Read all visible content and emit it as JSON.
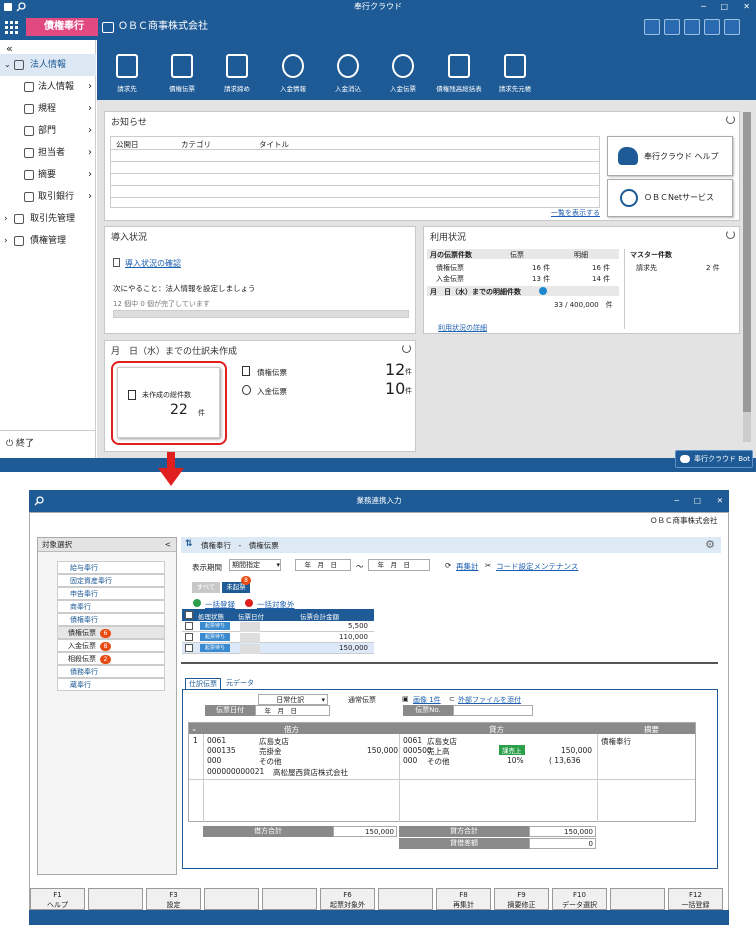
{
  "top_window": {
    "title": "奉行クラウド",
    "app_name": "債権奉行",
    "company": "ＯＢＣ商事株式会社",
    "collapse": "«",
    "nav": [
      {
        "label": "法人情報"
      },
      {
        "label": "法人情報"
      },
      {
        "label": "規程"
      },
      {
        "label": "部門"
      },
      {
        "label": "担当者"
      },
      {
        "label": "摘要"
      },
      {
        "label": "取引銀行"
      },
      {
        "label": "取引先管理"
      },
      {
        "label": "債権管理"
      }
    ],
    "exit_label": "終了",
    "ribbon": [
      "請求先",
      "債権伝票",
      "請求締め",
      "入金情報",
      "入金消込",
      "入金伝票",
      "債権残高総括表",
      "請求先元帳"
    ],
    "notice": {
      "title": "お知らせ",
      "columns": [
        "公開日",
        "カテゴリ",
        "タイトル"
      ],
      "show_all": "一覧を表示する"
    },
    "help_button": "奉行クラウド ヘルプ",
    "obcnet_button": "ＯＢＣNetサービス",
    "intro": {
      "title": "導入状況",
      "confirm_link": "導入状況の確認",
      "next_todo": "次にやること：法人情報を設定しましょう",
      "progress_text": "12 個中 0 個が完了しています",
      "progress_done": 0,
      "progress_total": 12
    },
    "usage": {
      "title": "利用状況",
      "month_header": "月の伝票件数",
      "col_slip": "伝票",
      "col_detail": "明細",
      "rows": [
        {
          "label": "債権伝票",
          "slips": "16 件",
          "details": "16 件"
        },
        {
          "label": "入金伝票",
          "slips": "13 件",
          "details": "14 件"
        }
      ],
      "detail_count_header": "月　日（水）までの明細件数",
      "detail_count": "33 / 400,000　件",
      "detail_link": "利用状況の詳細",
      "master_header": "マスター件数",
      "master_label": "請求先",
      "master_value": "2 件"
    },
    "unjournal": {
      "title": "月　日（水）までの仕訳未作成",
      "card_label": "未作成の総件数",
      "card_value": "22",
      "card_unit": "件",
      "slip1_label": "債権伝票",
      "slip1_count": "12",
      "slip2_label": "入金伝票",
      "slip2_count": "10",
      "unit": "件"
    },
    "bot_button": "奉行クラウド Bot"
  },
  "bottom_window": {
    "title": "業務連携入力",
    "company": "ＯＢＣ商事株式会社",
    "target_label": "対象選択",
    "tree": [
      {
        "label": "給与奉行",
        "badge": ""
      },
      {
        "label": "固定資産奉行",
        "badge": ""
      },
      {
        "label": "申告奉行",
        "badge": ""
      },
      {
        "label": "商奉行",
        "badge": ""
      },
      {
        "label": "債権奉行",
        "badge": ""
      },
      {
        "label": "債権伝票",
        "badge": "6"
      },
      {
        "label": "入金伝票",
        "badge": "8"
      },
      {
        "label": "相殺伝票",
        "badge": "2"
      },
      {
        "label": "債務奉行",
        "badge": ""
      },
      {
        "label": "蔵奉行",
        "badge": ""
      }
    ],
    "breadcrumb": "債権奉行　-　債権伝票",
    "period_label": "表示期間",
    "period_select": "期間指定",
    "date_from": "　年　月　日",
    "date_sep": "～",
    "date_to": "　年　月　日",
    "recalc_link": "再集計",
    "code_link": "コード設定メンテナンス",
    "filter_all": "すべて",
    "filter_unjournal": "未起票",
    "filter_badge": "8",
    "bulk_register": "一括登録",
    "bulk_exclude": "一括対象外",
    "list_columns": [
      "処理状態",
      "伝票日付",
      "伝票合計金額"
    ],
    "list_rows": [
      {
        "status": "起票待ち",
        "date": "　　　",
        "amount": "5,500"
      },
      {
        "status": "起票待ち",
        "date": "　　　",
        "amount": "110,000"
      },
      {
        "status": "起票待ち",
        "date": "　　　",
        "amount": "150,000"
      }
    ],
    "tabs": [
      "仕訳伝票",
      "元データ"
    ],
    "journal_type": "日常仕訳",
    "slip_kind": "通常伝票",
    "image_link": "画像 1件",
    "attach_link": "外部ファイルを添付",
    "slip_date_label": "伝票日付",
    "slip_date": "　年　月　日",
    "slip_no_label": "伝票No.",
    "grid_debit": "借方",
    "grid_credit": "貸方",
    "grid_memo": "摘要",
    "entry": {
      "no": "1",
      "d_dept_code": "0061",
      "d_dept": "広島支店",
      "d_acct_code": "000135",
      "d_acct": "売掛金",
      "d_amount": "150,000",
      "d_sub_code": "000",
      "d_sub": "その他",
      "d_partner_code": "000000000021",
      "d_partner": "高松屋西貨店株式会社",
      "c_dept_code": "0061",
      "c_dept": "広島支店",
      "c_acct_code": "000500",
      "c_acct": "売上高",
      "c_tax_tag": "課売上",
      "c_amount": "150,000",
      "c_sub_code": "000",
      "c_sub": "その他",
      "c_tax_rate": "10%",
      "c_tax_amount": "( 13,636",
      "memo": "債権奉行"
    },
    "debit_total_label": "借方合計",
    "debit_total": "150,000",
    "credit_total_label": "貸方合計",
    "credit_total": "150,000",
    "diff_label": "貸借差額",
    "diff_value": "0",
    "fkeys": [
      {
        "key": "F1",
        "label": "ヘルプ"
      },
      {
        "key": "",
        "label": ""
      },
      {
        "key": "F3",
        "label": "設定"
      },
      {
        "key": "",
        "label": ""
      },
      {
        "key": "",
        "label": ""
      },
      {
        "key": "F6",
        "label": "起票対象外"
      },
      {
        "key": "",
        "label": ""
      },
      {
        "key": "F8",
        "label": "再集計"
      },
      {
        "key": "F9",
        "label": "摘要修正"
      },
      {
        "key": "F10",
        "label": "データ選択"
      },
      {
        "key": "",
        "label": ""
      },
      {
        "key": "F12",
        "label": "一括登録"
      }
    ]
  },
  "colors": {
    "brand": "#1d5a96",
    "accent": "#e04a80",
    "highlight": "#e0201f",
    "badge": "#e84c15"
  }
}
